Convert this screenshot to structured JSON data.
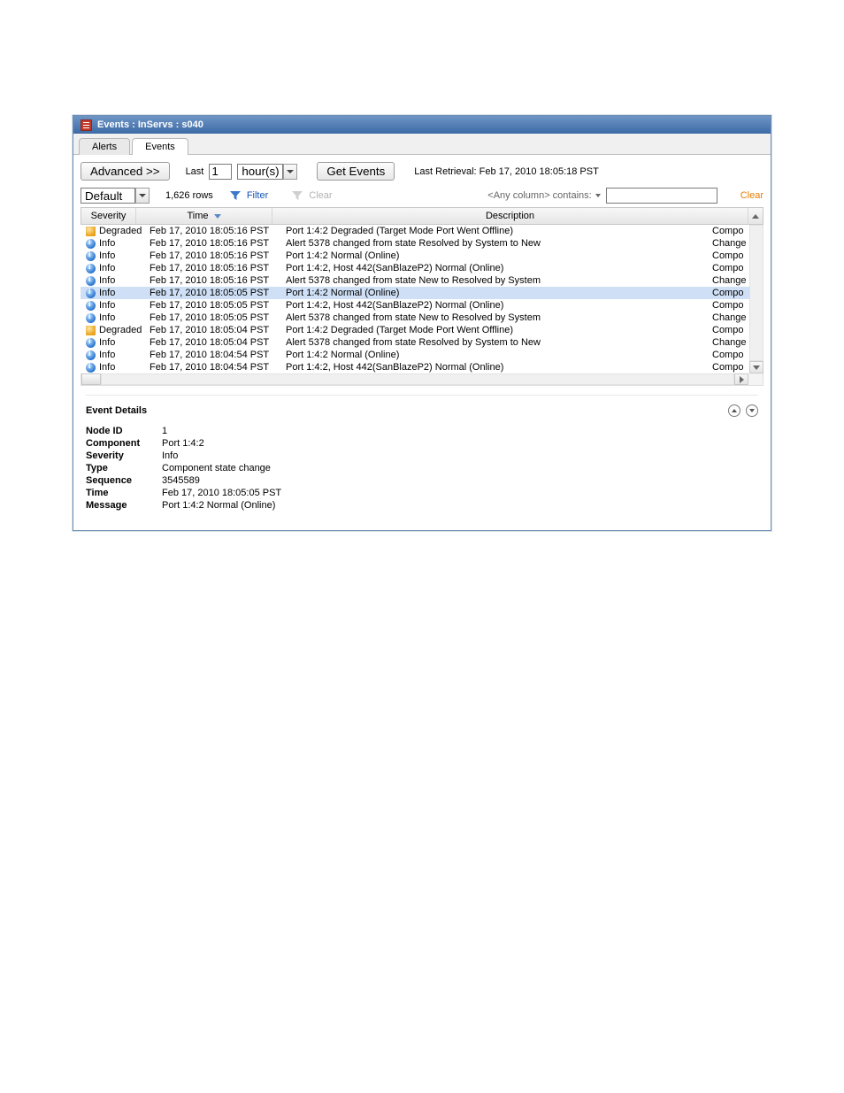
{
  "window": {
    "title": "Events : InServs : s040"
  },
  "tabs": [
    {
      "label": "Alerts",
      "active": false
    },
    {
      "label": "Events",
      "active": true
    }
  ],
  "toolbar": {
    "advanced": "Advanced >>",
    "last_label": "Last",
    "last_value": "1",
    "last_unit": "hour(s)",
    "get_events": "Get Events",
    "last_retrieval": "Last Retrieval: Feb 17, 2010 18:05:18 PST"
  },
  "filterbar": {
    "view": "Default",
    "row_count": "1,626 rows",
    "filter": "Filter",
    "clear": "Clear",
    "anycol": "<Any column> contains:",
    "clear_right": "Clear"
  },
  "columns": {
    "severity": "Severity",
    "time": "Time",
    "description": "Description"
  },
  "rows": [
    {
      "sev": "Degraded",
      "icon": "degraded",
      "time": "Feb 17, 2010 18:05:16 PST",
      "desc": "Port 1:4:2 Degraded (Target Mode Port Went Offline)",
      "r": "Compo"
    },
    {
      "sev": "Info",
      "icon": "info",
      "time": "Feb 17, 2010 18:05:16 PST",
      "desc": "Alert 5378 changed from state Resolved by System to New",
      "r": "Change"
    },
    {
      "sev": "Info",
      "icon": "info",
      "time": "Feb 17, 2010 18:05:16 PST",
      "desc": "Port 1:4:2 Normal (Online)",
      "r": "Compo"
    },
    {
      "sev": "Info",
      "icon": "info",
      "time": "Feb 17, 2010 18:05:16 PST",
      "desc": "Port 1:4:2, Host 442(SanBlazeP2) Normal (Online)",
      "r": "Compo"
    },
    {
      "sev": "Info",
      "icon": "info",
      "time": "Feb 17, 2010 18:05:16 PST",
      "desc": "Alert 5378 changed from state New to Resolved by System",
      "r": "Change"
    },
    {
      "sev": "Info",
      "icon": "info",
      "time": "Feb 17, 2010 18:05:05 PST",
      "desc": "Port 1:4:2 Normal (Online)",
      "r": "Compo",
      "selected": true
    },
    {
      "sev": "Info",
      "icon": "info",
      "time": "Feb 17, 2010 18:05:05 PST",
      "desc": "Port 1:4:2, Host 442(SanBlazeP2) Normal (Online)",
      "r": "Compo"
    },
    {
      "sev": "Info",
      "icon": "info",
      "time": "Feb 17, 2010 18:05:05 PST",
      "desc": "Alert 5378 changed from state New to Resolved by System",
      "r": "Change"
    },
    {
      "sev": "Degraded",
      "icon": "degraded",
      "time": "Feb 17, 2010 18:05:04 PST",
      "desc": "Port 1:4:2 Degraded (Target Mode Port Went Offline)",
      "r": "Compo"
    },
    {
      "sev": "Info",
      "icon": "info",
      "time": "Feb 17, 2010 18:05:04 PST",
      "desc": "Alert 5378 changed from state Resolved by System to New",
      "r": "Change"
    },
    {
      "sev": "Info",
      "icon": "info",
      "time": "Feb 17, 2010 18:04:54 PST",
      "desc": "Port 1:4:2 Normal (Online)",
      "r": "Compo"
    },
    {
      "sev": "Info",
      "icon": "info",
      "time": "Feb 17, 2010 18:04:54 PST",
      "desc": "Port 1:4:2, Host 442(SanBlazeP2) Normal (Online)",
      "r": "Compo"
    }
  ],
  "details": {
    "title": "Event Details",
    "node_id_k": "Node ID",
    "node_id": "1",
    "component_k": "Component",
    "component": "Port 1:4:2",
    "severity_k": "Severity",
    "severity": "Info",
    "type_k": "Type",
    "type": "Component state change",
    "sequence_k": "Sequence",
    "sequence": "3545589",
    "time_k": "Time",
    "time": "Feb 17, 2010 18:05:05 PST",
    "message_k": "Message",
    "message": "Port 1:4:2 Normal (Online)"
  }
}
